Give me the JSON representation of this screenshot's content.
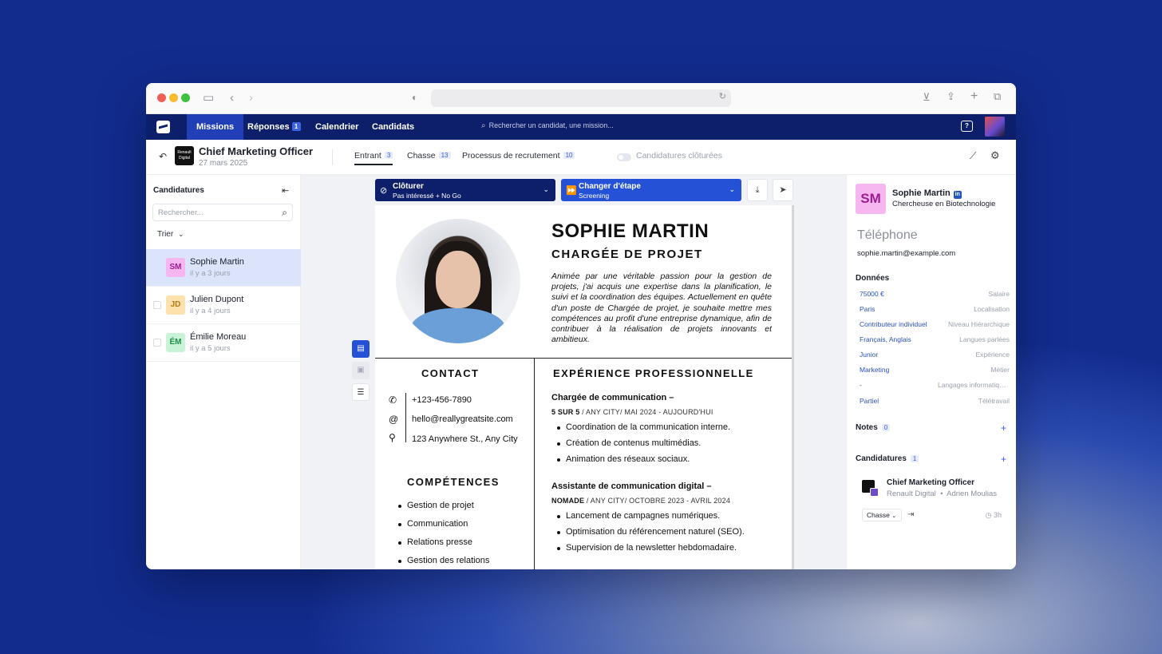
{
  "topnav": {
    "items": [
      {
        "label": "Missions",
        "active": true
      },
      {
        "label": "Réponses",
        "badge": "1"
      },
      {
        "label": "Calendrier"
      },
      {
        "label": "Candidats"
      }
    ],
    "search_placeholder": "Rechercher un candidat, une mission..."
  },
  "mission": {
    "company_logo_text": "Renault Digital",
    "title": "Chief Marketing Officer",
    "date": "27 mars 2025",
    "tabs": [
      {
        "label": "Entrant",
        "count": "3",
        "active": true
      },
      {
        "label": "Chasse",
        "count": "13"
      },
      {
        "label": "Processus de recrutement",
        "count": "10"
      }
    ],
    "closed_toggle_label": "Candidatures clôturées"
  },
  "sidebar": {
    "title": "Candidatures",
    "search_placeholder": "Rechercher...",
    "sort_label": "Trier",
    "candidates": [
      {
        "initials": "SM",
        "name": "Sophie Martin",
        "time": "il y a 3 jours",
        "bg": "#f6b6f0",
        "fg": "#9b1f8f",
        "selected": true
      },
      {
        "initials": "JD",
        "name": "Julien Dupont",
        "time": "il y a 4 jours",
        "bg": "#fde2ad",
        "fg": "#b47a16"
      },
      {
        "initials": "ÉM",
        "name": "Émilie Moreau",
        "time": "il y a 5 jours",
        "bg": "#c9f3d6",
        "fg": "#1f8f48"
      }
    ]
  },
  "actions": {
    "close": {
      "label": "Clôturer",
      "sub": "Pas intéressé + No Go"
    },
    "stage": {
      "label": "Changer d'étape",
      "sub": "Screening"
    }
  },
  "cv": {
    "name": "SOPHIE MARTIN",
    "role": "CHARGÉE DE PROJET",
    "bio": "Animée par une véritable passion pour la gestion de projets, j'ai acquis une expertise dans la planification, le suivi et la coordination des équipes. Actuellement en quête d'un poste de Chargée de projet, je souhaite mettre mes compétences au profit d'une entreprise dynamique, afin de contribuer à la réalisation de projets innovants et ambitieux.",
    "contact_title": "CONTACT",
    "phone": "+123-456-7890",
    "email": "hello@reallygreatsite.com",
    "address": "123 Anywhere St., Any City",
    "skills_title": "COMPÉTENCES",
    "skills": [
      "Gestion de projet",
      "Communication",
      "Relations presse",
      "Gestion des relations"
    ],
    "experience_title": "EXPÉRIENCE PROFESSIONNELLE",
    "jobs": [
      {
        "title": "Chargée de communication –",
        "company": "5 SUR 5",
        "meta": " / ANY CITY/ MAI 2024 - AUJOURD'HUI",
        "tasks": [
          "Coordination de la communication interne.",
          "Création de contenus multimédias.",
          "Animation des réseaux sociaux."
        ]
      },
      {
        "title": "Assistante de communication digital –",
        "company": "NOMADE",
        "meta": " / ANY CITY/ OCTOBRE 2023 - AVRIL 2024",
        "tasks": [
          "Lancement de campagnes numériques.",
          "Optimisation du référencement naturel (SEO).",
          "Supervision de la newsletter hebdomadaire."
        ]
      }
    ]
  },
  "profile": {
    "initials": "SM",
    "name": "Sophie Martin",
    "linkedin": "in",
    "job": "Chercheuse en Biotechnologie",
    "phone_label": "Téléphone",
    "email": "sophie.martin@example.com",
    "data_title": "Données",
    "data": [
      {
        "value": "75000 €",
        "label": "Salaire"
      },
      {
        "value": "Paris",
        "label": "Localisation"
      },
      {
        "value": "Contributeur individuel",
        "label": "Niveau Hiérarchique"
      },
      {
        "value": "Français, Anglais",
        "label": "Langues parlées"
      },
      {
        "value": "Junior",
        "label": "Expérience"
      },
      {
        "value": "Marketing",
        "label": "Métier"
      },
      {
        "value": "-",
        "label": "Langages informatiques"
      },
      {
        "value": "Partiel",
        "label": "Télétravail"
      }
    ],
    "notes_title": "Notes",
    "notes_count": "0",
    "applications_title": "Candidatures",
    "applications_count": "1",
    "application": {
      "title": "Chief Marketing Officer",
      "company": "Renault Digital",
      "recruiter": "Adrien Moulias",
      "stage": "Chasse",
      "time": "3h"
    }
  },
  "colors": {
    "navy": "#0d1f6b",
    "accent": "#2451d6",
    "selected_row": "#dbe4fb"
  }
}
